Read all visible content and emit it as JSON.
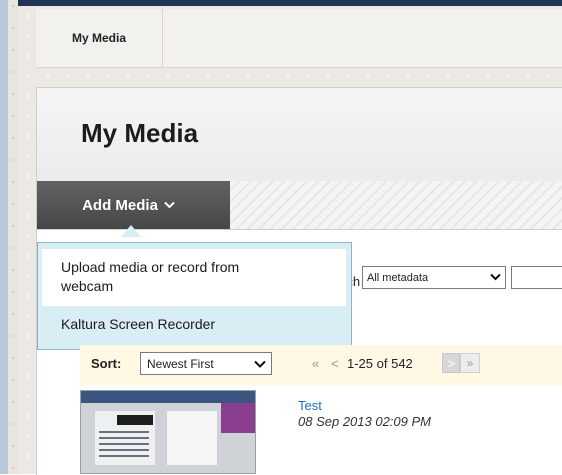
{
  "breadcrumb": {
    "item": "My Media"
  },
  "page": {
    "title": "My Media"
  },
  "action_bar": {
    "add_media_label": "Add Media",
    "add_media_chevron": "⌄"
  },
  "dropdown": {
    "items": [
      {
        "label_line1": "Upload media or record from",
        "label_line2": "webcam"
      },
      {
        "label": "Kaltura Screen Recorder"
      }
    ]
  },
  "search": {
    "label_fragment": "rch",
    "field_selected": "All metadata",
    "input_value": ""
  },
  "sort": {
    "label": "Sort:",
    "selected": "Newest First"
  },
  "pagination": {
    "first": "«",
    "prev": "<",
    "range": "1-25 of 542",
    "next": ">",
    "last": "»"
  },
  "media": [
    {
      "title": "Test",
      "date": "08 Sep 2013 02:09 PM"
    }
  ],
  "colors": {
    "header_line": "#1e3556",
    "link": "#1f6fbf",
    "dropdown_bg": "#d9edf5",
    "add_media_bg": "#4f4f4f",
    "sort_bar_bg": "#fff8e4"
  }
}
